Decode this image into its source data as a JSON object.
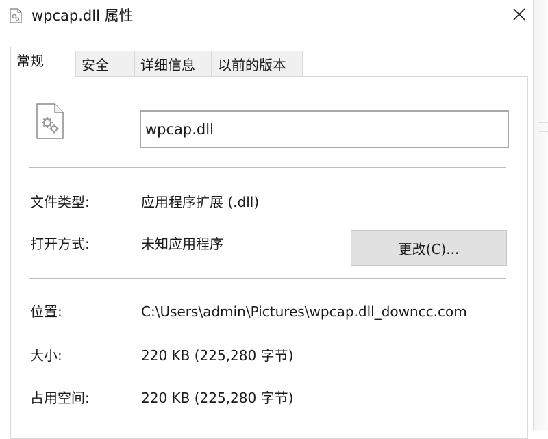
{
  "window": {
    "title": "wpcap.dll 属性"
  },
  "tabs": [
    {
      "label": "常规",
      "active": true
    },
    {
      "label": "安全",
      "active": false
    },
    {
      "label": "详细信息",
      "active": false
    },
    {
      "label": "以前的版本",
      "active": false
    }
  ],
  "general": {
    "file_name": "wpcap.dll",
    "file_type_label": "文件类型:",
    "file_type_value": "应用程序扩展 (.dll)",
    "opens_with_label": "打开方式:",
    "opens_with_value": "未知应用程序",
    "change_button_label": "更改(C)...",
    "location_label": "位置:",
    "location_value": "C:\\Users\\admin\\Pictures\\wpcap.dll_downcc.com",
    "size_label": "大小:",
    "size_value": "220 KB (225,280 字节)",
    "size_on_disk_label": "占用空间:",
    "size_on_disk_value": "220 KB (225,280 字节)"
  },
  "icons": {
    "title_icon": "dll-file-icon",
    "close": "close-icon",
    "file": "dll-gear-file-icon"
  }
}
